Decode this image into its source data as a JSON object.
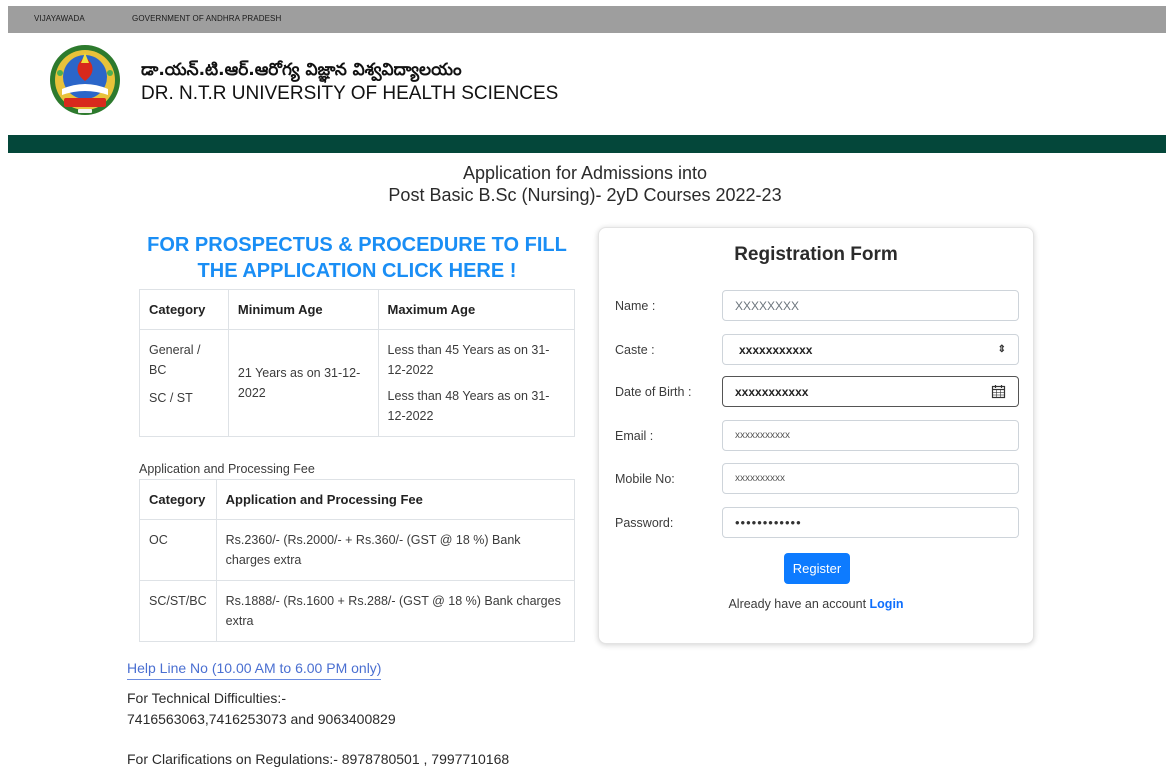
{
  "topbar": {
    "link1": "VIJAYAWADA",
    "link2": "GOVERNMENT OF ANDHRA PRADESH"
  },
  "header": {
    "logo_icon": "university-emblem-icon",
    "title_telugu": "డా.యన్.టి.ఆర్.ఆరోగ్య విజ్ఞాన విశ్వవిద్యాలయం",
    "title_english": "DR. N.T.R UNIVERSITY OF HEALTH SCIENCES"
  },
  "app_title": {
    "line1": "Application for Admissions into",
    "line2": "Post Basic B.Sc (Nursing)- 2yD Courses 2022-23"
  },
  "prospectus": {
    "line1": "FOR PROSPECTUS & PROCEDURE TO FILL",
    "line2": "THE APPLICATION CLICK HERE !"
  },
  "age_table": {
    "headers": [
      "Category",
      "Minimum Age",
      "Maximum Age"
    ],
    "cat1": "General / BC",
    "cat2": "SC / ST",
    "min_age": "21 Years as on 31-12-2022",
    "max1": "Less than 45 Years as on 31-12-2022",
    "max2": "Less than 48 Years as on 31-12-2022"
  },
  "fee": {
    "caption": "Application and Processing Fee",
    "headers": [
      "Category",
      "Application and Processing Fee"
    ],
    "rows": [
      {
        "category": "OC",
        "fee": "Rs.2360/- (Rs.2000/- + Rs.360/- (GST @ 18 %) Bank charges extra"
      },
      {
        "category": "SC/ST/BC",
        "fee": "Rs.1888/- (Rs.1600 + Rs.288/- (GST @ 18 %) Bank charges extra"
      }
    ]
  },
  "help": {
    "helpline": "Help Line No (10.00 AM to 6.00 PM only)",
    "tech_label": "For Technical Difficulties:-",
    "tech_numbers": "7416563063,7416253073 and 9063400829",
    "clarifications": "For Clarifications on Regulations:- 8978780501 , 7997710168"
  },
  "form": {
    "title": "Registration Form",
    "name_label": "Name :",
    "name_value": "XXXXXXXX",
    "caste_label": "Caste :",
    "caste_value": "xxxxxxxxxxx",
    "dob_label": "Date of Birth :",
    "dob_value": "xxxxxxxxxxx",
    "email_label": "Email :",
    "email_value": "xxxxxxxxxxx",
    "mobile_label": "Mobile No:",
    "mobile_value": "xxxxxxxxxx",
    "password_label": "Password:",
    "password_value": "••••••••••••",
    "register_label": "Register",
    "already_text": "Already have an account ",
    "login_label": "Login",
    "icons": {
      "caste_caret": "up-down-caret-icon",
      "calendar": "calendar-icon"
    }
  }
}
